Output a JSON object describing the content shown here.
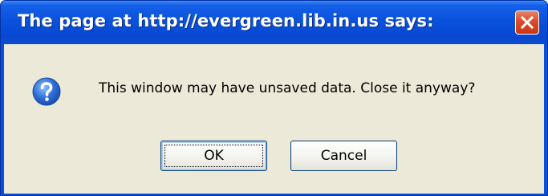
{
  "dialog": {
    "title": "The page at http://evergreen.lib.in.us says:",
    "message": "This window may have unsaved data. Close it anyway?",
    "icon": "question-icon",
    "buttons": {
      "ok_label": "OK",
      "cancel_label": "Cancel"
    },
    "close_icon": "close-icon"
  },
  "colors": {
    "titlebar": "#0a52dc",
    "client_background": "#ece9d8",
    "close_button": "#da4c2a",
    "icon": "#2f6fd6"
  }
}
